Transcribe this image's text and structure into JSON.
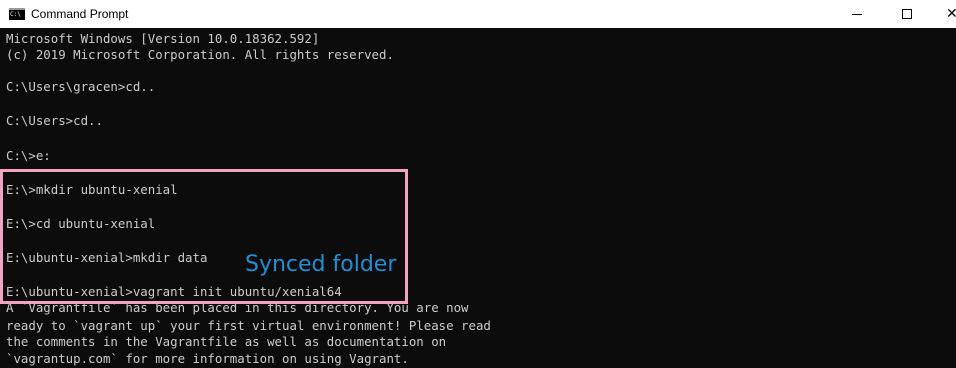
{
  "window": {
    "title": "Command Prompt",
    "icon": "cmd-icon",
    "icon_text": "C:\\",
    "controls": {
      "minimize": "minimize-icon",
      "maximize": "maximize-icon",
      "close": "close-icon"
    }
  },
  "console": {
    "lines": [
      "Microsoft Windows [Version 10.0.18362.592]",
      "(c) 2019 Microsoft Corporation. All rights reserved.",
      "",
      "C:\\Users\\gracen>cd..",
      "",
      "C:\\Users>cd..",
      "",
      "C:\\>e:",
      "",
      "E:\\>mkdir ubuntu-xenial",
      "",
      "E:\\>cd ubuntu-xenial",
      "",
      "E:\\ubuntu-xenial>mkdir data",
      "",
      "E:\\ubuntu-xenial>vagrant init ubuntu/xenial64",
      "A `Vagrantfile` has been placed in this directory. You are now",
      "ready to `vagrant up` your first virtual environment! Please read",
      "the comments in the Vagrantfile as well as documentation on",
      "`vagrantup.com` for more information on using Vagrant."
    ]
  },
  "annotation": {
    "label": "Synced folder",
    "box_color": "#f2a3c2",
    "text_color": "#1f8fd6"
  },
  "colors": {
    "console_bg": "#0c0c0c",
    "console_fg": "#cccccc",
    "titlebar_bg": "#ffffff"
  }
}
